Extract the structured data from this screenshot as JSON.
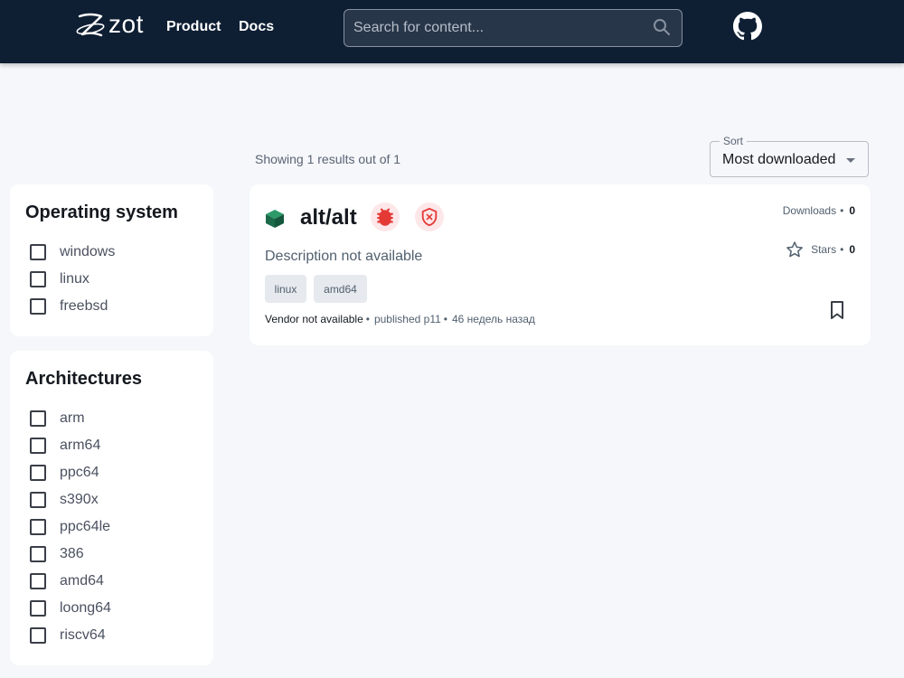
{
  "header": {
    "logo_text": "zot",
    "nav": {
      "product": "Product",
      "docs": "Docs"
    },
    "search_placeholder": "Search for content..."
  },
  "filters": {
    "os": {
      "title": "Operating system",
      "options": [
        "windows",
        "linux",
        "freebsd"
      ]
    },
    "arch": {
      "title": "Architectures",
      "options": [
        "arm",
        "arm64",
        "ppc64",
        "s390x",
        "ppc64le",
        "386",
        "amd64",
        "loong64",
        "riscv64"
      ]
    }
  },
  "results": {
    "count_text": "Showing 1 results out of 1",
    "sort_label": "Sort",
    "sort_value": "Most downloaded"
  },
  "repo": {
    "name": "alt/alt",
    "description": "Description not available",
    "tags": [
      "linux",
      "amd64"
    ],
    "vendor": "Vendor not available",
    "published": "published p11",
    "time": "46 недель назад",
    "downloads_label": "Downloads",
    "downloads": "0",
    "stars_label": "Stars",
    "stars": "0"
  },
  "colors": {
    "header_bg": "#0e1e33",
    "page_bg": "#f5f7fa",
    "danger": "#e53935",
    "repo_icon": "#1b6b4a"
  },
  "icons": [
    "zot-logo-icon",
    "search-icon",
    "github-icon",
    "package-icon",
    "bug-icon",
    "shield-x-icon",
    "star-icon",
    "bookmark-icon"
  ]
}
